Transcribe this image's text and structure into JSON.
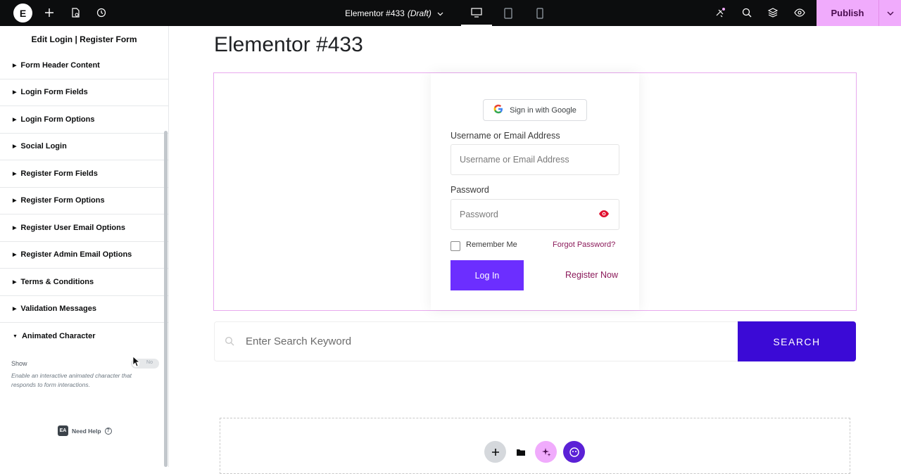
{
  "topbar": {
    "logo_letter": "E",
    "doc_title": "Elementor #433",
    "doc_status": "(Draft)",
    "publish_label": "Publish"
  },
  "sidebar": {
    "title": "Edit Login | Register Form",
    "sections": [
      {
        "label": "Form Header Content",
        "open": false
      },
      {
        "label": "Login Form Fields",
        "open": false
      },
      {
        "label": "Login Form Options",
        "open": false
      },
      {
        "label": "Social Login",
        "open": false
      },
      {
        "label": "Register Form Fields",
        "open": false
      },
      {
        "label": "Register Form Options",
        "open": false
      },
      {
        "label": "Register User Email Options",
        "open": false
      },
      {
        "label": "Register Admin Email Options",
        "open": false
      },
      {
        "label": "Terms & Conditions",
        "open": false
      },
      {
        "label": "Validation Messages",
        "open": false
      },
      {
        "label": "Animated Character",
        "open": true
      }
    ],
    "show_label": "Show",
    "toggle_text": "No",
    "show_description": "Enable an interactive animated character that responds to form interactions.",
    "need_help": "Need Help",
    "need_help_badge": "EA"
  },
  "canvas": {
    "page_title": "Elementor #433",
    "google_btn": "Sign in with Google",
    "username_label": "Username or Email Address",
    "username_placeholder": "Username or Email Address",
    "password_label": "Password",
    "password_placeholder": "Password",
    "remember_label": "Remember Me",
    "forgot_label": "Forgot Password?",
    "login_btn": "Log In",
    "register_link": "Register Now",
    "search_placeholder": "Enter Search Keyword",
    "search_btn": "SEARCH"
  },
  "colors": {
    "publish_bg": "#f0abfc",
    "login_btn_bg": "#6c2eff",
    "search_btn_bg": "#3b0ad6",
    "link": "#8b1a5a"
  }
}
